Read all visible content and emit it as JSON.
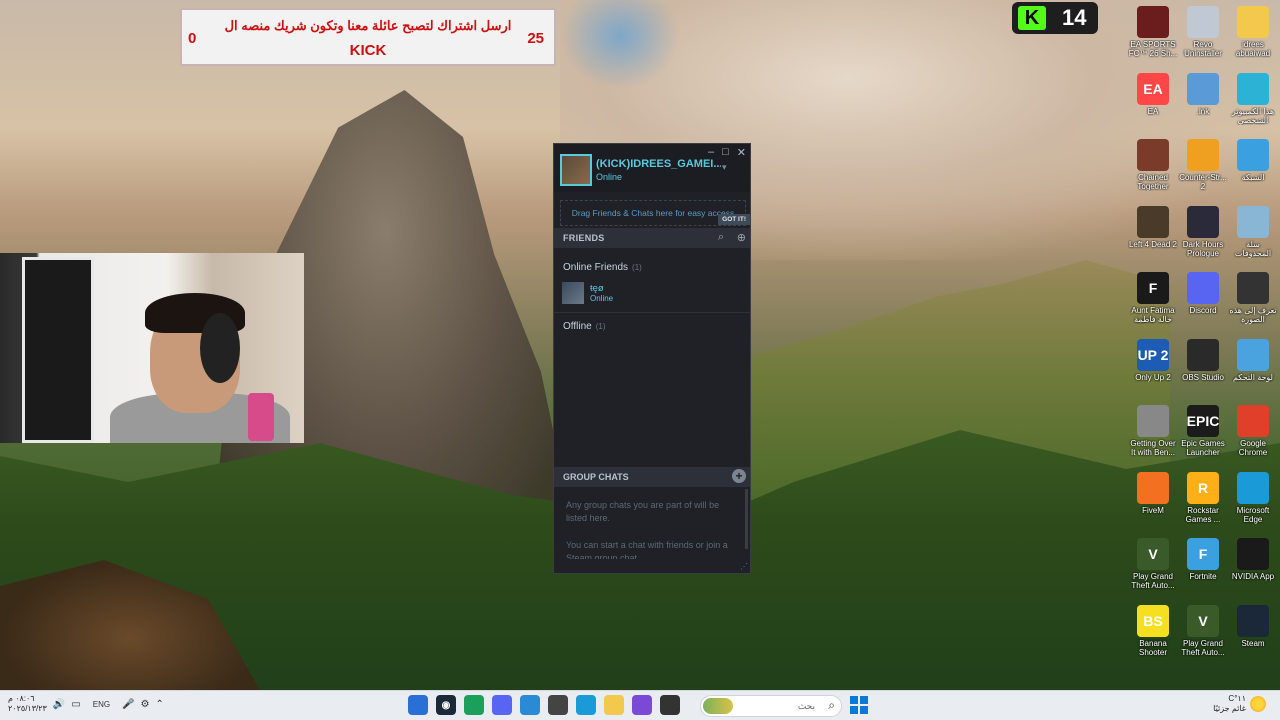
{
  "banner": {
    "left_count": "0",
    "right_count": "25",
    "message": "ارسل اشتراك لتصبح عائلة معنا وتكون شريك منصه ال",
    "platform": "KICK"
  },
  "kick_badge": {
    "logo": "K",
    "count": "14"
  },
  "steam": {
    "username": "(KICK)IDREES_GAMEI...",
    "user_status": "Online",
    "drag_hint": "Drag Friends & Chats here for easy access",
    "got_it": "GOT IT!",
    "friends_header": "FRIENDS",
    "online_friends_label": "Online Friends",
    "online_friends_count": "(1)",
    "friend_name": "ŧęø",
    "friend_status": "Online",
    "offline_label": "Offline",
    "offline_count": "(1)",
    "group_chats_header": "GROUP CHATS",
    "group_empty_1": "Any group chats you are part of will be listed here.",
    "group_empty_2": "You can start a chat with friends or join a Steam group chat."
  },
  "desktop_icons": [
    {
      "label": "EA SPORTS FC™ 26 Sh...",
      "icon": "ea-fc-icon",
      "color": "#6b1c1c",
      "glyph": ""
    },
    {
      "label": "Revo Uninstaller",
      "icon": "revo-icon",
      "color": "#c0c8d4",
      "glyph": ""
    },
    {
      "label": "idrees abuaiwad",
      "icon": "folder-icon",
      "color": "#f2c94c",
      "glyph": ""
    },
    {
      "label": "EA",
      "icon": "ea-icon",
      "color": "#ff4747",
      "glyph": "EA"
    },
    {
      "label": ".lnk",
      "icon": "lnk-icon",
      "color": "#5a9ad6",
      "glyph": ""
    },
    {
      "label": "هذا الكمبيوتر الشخصي",
      "icon": "this-pc-icon",
      "color": "#2bb3d6",
      "glyph": ""
    },
    {
      "label": "Chained Together",
      "icon": "chained-together-icon",
      "color": "#7a3b2a",
      "glyph": ""
    },
    {
      "label": "Counter-Str... 2",
      "icon": "cs2-icon",
      "color": "#f0a020",
      "glyph": ""
    },
    {
      "label": "الشبكة",
      "icon": "network-icon",
      "color": "#3aa0e0",
      "glyph": ""
    },
    {
      "label": "Left 4 Dead 2",
      "icon": "l4d2-icon",
      "color": "#4a3a2a",
      "glyph": ""
    },
    {
      "label": "Dark Hours Prologue",
      "icon": "dark-hours-icon",
      "color": "#2a2a3a",
      "glyph": ""
    },
    {
      "label": "سلة المحذوفات",
      "icon": "recycle-bin-icon",
      "color": "#8ab6d6",
      "glyph": ""
    },
    {
      "label": "Aunt Fatima خالة فاطمة",
      "icon": "aunt-fatima-icon",
      "color": "#1a1a1a",
      "glyph": "F"
    },
    {
      "label": "Discord",
      "icon": "discord-icon",
      "color": "#5865f2",
      "glyph": ""
    },
    {
      "label": "تعرف إلى هذه الصورة",
      "icon": "spotlight-icon",
      "color": "#333333",
      "glyph": ""
    },
    {
      "label": "Only Up 2",
      "icon": "only-up-icon",
      "color": "#1e5bb5",
      "glyph": "UP 2"
    },
    {
      "label": "OBS Studio",
      "icon": "obs-icon",
      "color": "#2a2a2a",
      "glyph": ""
    },
    {
      "label": "لوحة التحكم",
      "icon": "control-panel-icon",
      "color": "#4aa3df",
      "glyph": ""
    },
    {
      "label": "Getting Over It with Ben...",
      "icon": "getting-over-it-icon",
      "color": "#888888",
      "glyph": ""
    },
    {
      "label": "Epic Games Launcher",
      "icon": "epic-games-icon",
      "color": "#1b1b1b",
      "glyph": "EPIC"
    },
    {
      "label": "Google Chrome",
      "icon": "chrome-icon",
      "color": "#e0402a",
      "glyph": ""
    },
    {
      "label": "FiveM",
      "icon": "fivem-icon",
      "color": "#f37021",
      "glyph": ""
    },
    {
      "label": "Rockstar Games ...",
      "icon": "rockstar-icon",
      "color": "#fcaf17",
      "glyph": "R"
    },
    {
      "label": "Microsoft Edge",
      "icon": "edge-icon",
      "color": "#1a9ad6",
      "glyph": ""
    },
    {
      "label": "Play Grand Theft Auto...",
      "icon": "gta-icon",
      "color": "#3a5a2a",
      "glyph": "V"
    },
    {
      "label": "Fortnite",
      "icon": "fortnite-icon",
      "color": "#3aa0e0",
      "glyph": "F"
    },
    {
      "label": "NVIDIA App",
      "icon": "nvidia-icon",
      "color": "#1a1a1a",
      "glyph": ""
    },
    {
      "label": "Banana Shooter",
      "icon": "banana-shooter-icon",
      "color": "#f5e020",
      "glyph": "BS"
    },
    {
      "label": "Play Grand Theft Auto...",
      "icon": "gta-icon-2",
      "color": "#3a5a2a",
      "glyph": "V"
    },
    {
      "label": "Steam",
      "icon": "steam-icon",
      "color": "#1b2838",
      "glyph": ""
    }
  ],
  "taskbar": {
    "time": "٠٨:٠٦ م",
    "date": "٢٠٢٥/١٣/٢٣",
    "language": "ENG",
    "search_placeholder": "بحث",
    "weather_temp": "١١°C",
    "weather_desc": "غائم جزئيًا"
  }
}
